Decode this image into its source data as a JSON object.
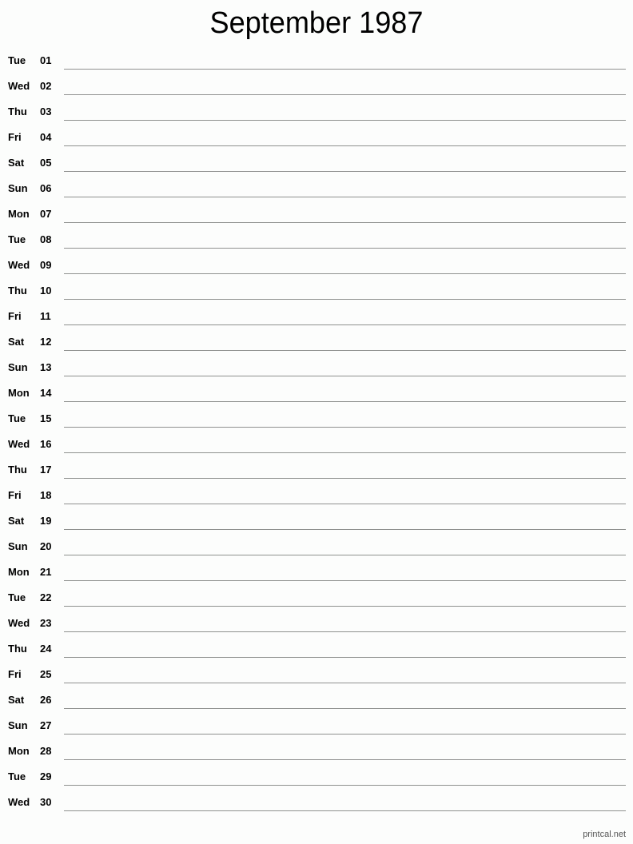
{
  "title": "September 1987",
  "days": [
    {
      "dow": "Tue",
      "num": "01"
    },
    {
      "dow": "Wed",
      "num": "02"
    },
    {
      "dow": "Thu",
      "num": "03"
    },
    {
      "dow": "Fri",
      "num": "04"
    },
    {
      "dow": "Sat",
      "num": "05"
    },
    {
      "dow": "Sun",
      "num": "06"
    },
    {
      "dow": "Mon",
      "num": "07"
    },
    {
      "dow": "Tue",
      "num": "08"
    },
    {
      "dow": "Wed",
      "num": "09"
    },
    {
      "dow": "Thu",
      "num": "10"
    },
    {
      "dow": "Fri",
      "num": "11"
    },
    {
      "dow": "Sat",
      "num": "12"
    },
    {
      "dow": "Sun",
      "num": "13"
    },
    {
      "dow": "Mon",
      "num": "14"
    },
    {
      "dow": "Tue",
      "num": "15"
    },
    {
      "dow": "Wed",
      "num": "16"
    },
    {
      "dow": "Thu",
      "num": "17"
    },
    {
      "dow": "Fri",
      "num": "18"
    },
    {
      "dow": "Sat",
      "num": "19"
    },
    {
      "dow": "Sun",
      "num": "20"
    },
    {
      "dow": "Mon",
      "num": "21"
    },
    {
      "dow": "Tue",
      "num": "22"
    },
    {
      "dow": "Wed",
      "num": "23"
    },
    {
      "dow": "Thu",
      "num": "24"
    },
    {
      "dow": "Fri",
      "num": "25"
    },
    {
      "dow": "Sat",
      "num": "26"
    },
    {
      "dow": "Sun",
      "num": "27"
    },
    {
      "dow": "Mon",
      "num": "28"
    },
    {
      "dow": "Tue",
      "num": "29"
    },
    {
      "dow": "Wed",
      "num": "30"
    }
  ],
  "footer": "printcal.net"
}
